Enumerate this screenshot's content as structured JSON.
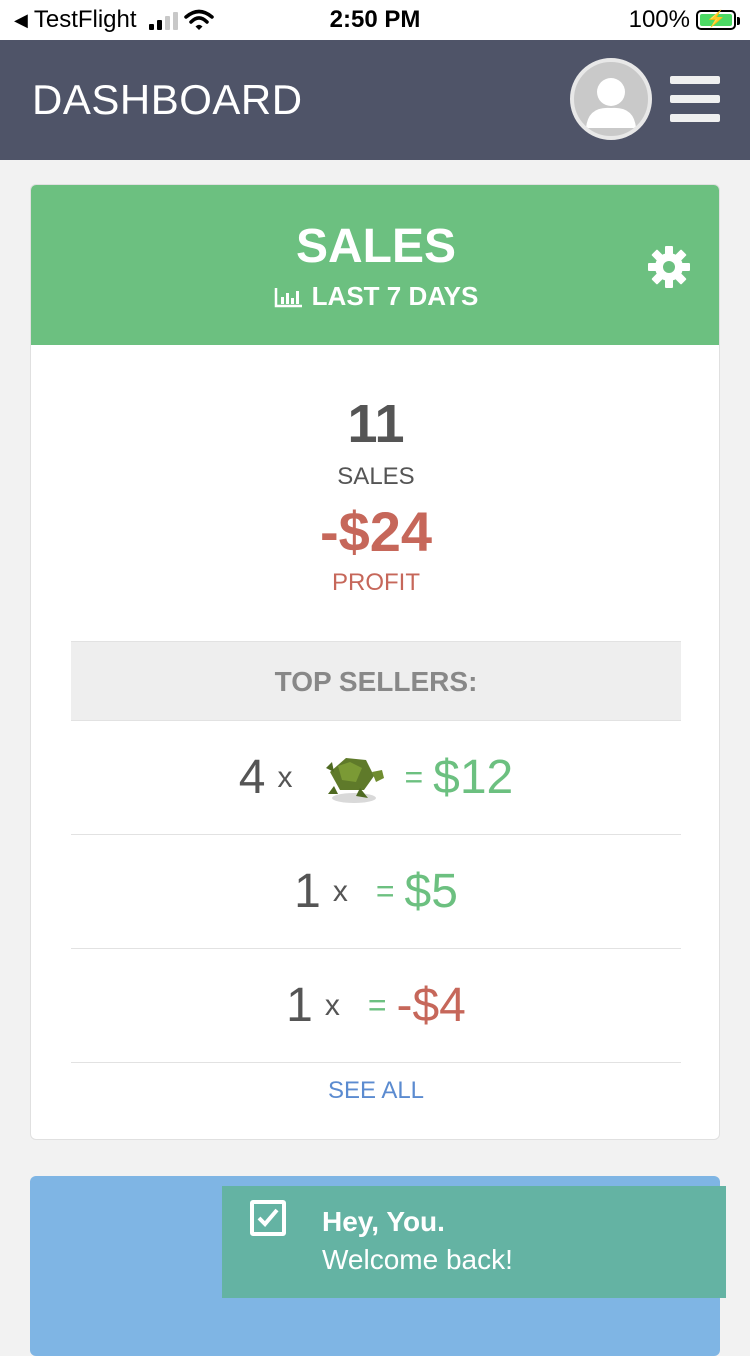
{
  "status_bar": {
    "back_app": "TestFlight",
    "time": "2:50 PM",
    "battery": "100%"
  },
  "header": {
    "title": "DASHBOARD"
  },
  "sales_card": {
    "title": "SALES",
    "period": "LAST 7 DAYS",
    "sales_count": "11",
    "sales_label": "SALES",
    "profit_value": "-$24",
    "profit_label": "PROFIT",
    "top_sellers_label": "TOP SELLERS:",
    "rows": [
      {
        "qty": "4",
        "times": "x",
        "eq": "=",
        "amount": "$12",
        "amount_color": "green",
        "has_image": true
      },
      {
        "qty": "1",
        "times": "x",
        "eq": "=",
        "amount": "$5",
        "amount_color": "green",
        "has_image": false
      },
      {
        "qty": "1",
        "times": "x",
        "eq": "=",
        "amount": "-$4",
        "amount_color": "red",
        "has_image": false
      }
    ],
    "see_all_label": "SEE ALL"
  },
  "toast": {
    "title": "Hey, You.",
    "message": "Welcome back!"
  },
  "colors": {
    "header_bg": "#4f5468",
    "sales_green": "#6cc080",
    "loss_red": "#c6675a",
    "link_blue": "#5b8bd0",
    "toast_bg": "#64b3a3",
    "card_blue": "#7fb5e4"
  },
  "icons": {
    "avatar": "user-avatar-icon",
    "menu": "hamburger-menu-icon",
    "settings": "gear-icon",
    "chart": "bar-chart-icon",
    "toast": "checkbox-check-icon"
  }
}
